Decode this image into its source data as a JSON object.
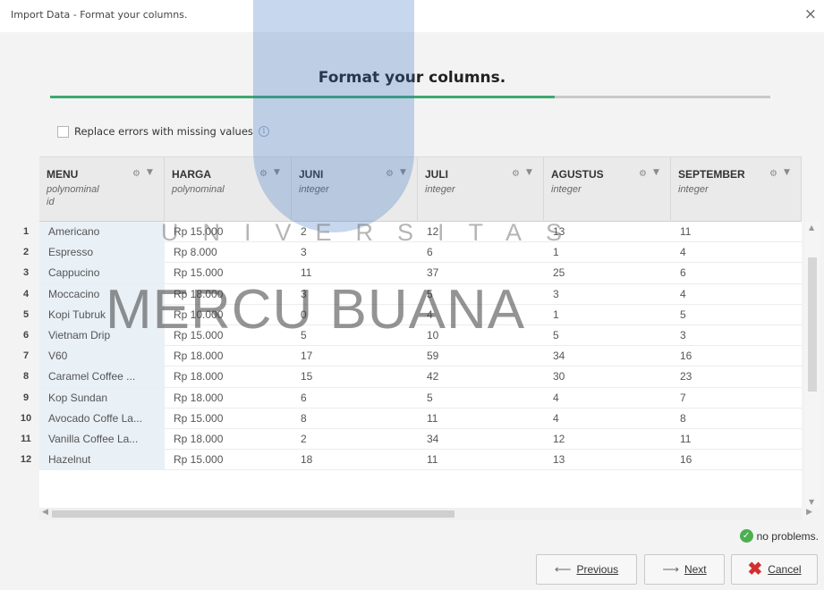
{
  "window": {
    "title": "Import Data - Format your columns.",
    "close_glyph": "×"
  },
  "heading": "Format your columns.",
  "progress": {
    "fraction": 0.7
  },
  "options": {
    "replace_errors_label": "Replace errors with missing values",
    "info_glyph": "i"
  },
  "columns": [
    {
      "name": "MENU",
      "type": "polynominal",
      "role": "id"
    },
    {
      "name": "HARGA",
      "type": "polynominal",
      "role": ""
    },
    {
      "name": "JUNI",
      "type": "integer",
      "role": ""
    },
    {
      "name": "JULI",
      "type": "integer",
      "role": ""
    },
    {
      "name": "AGUSTUS",
      "type": "integer",
      "role": ""
    },
    {
      "name": "SEPTEMBER",
      "type": "integer",
      "role": ""
    }
  ],
  "rows": [
    {
      "n": "1",
      "cells": [
        "Americano",
        "Rp 15.000",
        "2",
        "12",
        "13",
        "11"
      ]
    },
    {
      "n": "2",
      "cells": [
        "Espresso",
        "Rp 8.000",
        "3",
        "6",
        "1",
        "4"
      ]
    },
    {
      "n": "3",
      "cells": [
        "Cappucino",
        "Rp 15.000",
        "11",
        "37",
        "25",
        "6"
      ]
    },
    {
      "n": "4",
      "cells": [
        "Moccacino",
        "Rp 18.000",
        "3",
        "5",
        "3",
        "4"
      ]
    },
    {
      "n": "5",
      "cells": [
        "Kopi Tubruk",
        "Rp 10.000",
        "0",
        "4",
        "1",
        "5"
      ]
    },
    {
      "n": "6",
      "cells": [
        "Vietnam Drip",
        "Rp 15.000",
        "5",
        "10",
        "5",
        "3"
      ]
    },
    {
      "n": "7",
      "cells": [
        "V60",
        "Rp 18.000",
        "17",
        "59",
        "34",
        "16"
      ]
    },
    {
      "n": "8",
      "cells": [
        "Caramel Coffee ...",
        "Rp 18.000",
        "15",
        "42",
        "30",
        "23"
      ]
    },
    {
      "n": "9",
      "cells": [
        "Kop Sundan",
        "Rp 18.000",
        "6",
        "5",
        "4",
        "7"
      ]
    },
    {
      "n": "10",
      "cells": [
        "Avocado Coffe La...",
        "Rp 15.000",
        "8",
        "11",
        "4",
        "8"
      ]
    },
    {
      "n": "11",
      "cells": [
        "Vanilla Coffee La...",
        "Rp 18.000",
        "2",
        "34",
        "12",
        "11"
      ]
    },
    {
      "n": "12",
      "cells": [
        "Hazelnut",
        "Rp 15.000",
        "18",
        "11",
        "13",
        "16"
      ]
    }
  ],
  "status": {
    "text": "no problems.",
    "icon": "check-circle-icon",
    "icon_glyph": "✓"
  },
  "buttons": {
    "previous": "Previous",
    "next": "Next",
    "cancel": "Cancel",
    "left_arrow_glyph": "⟵",
    "right_arrow_glyph": "⟶",
    "cancel_glyph": "✖"
  },
  "watermark": {
    "line1": "UNIVERSITAS",
    "line2": "MERCU BUANA"
  },
  "colors": {
    "progress": "#3fa971",
    "menu_column_bg": "#e9f0f6",
    "ok": "#4caf50",
    "cancel_icon": "#d32f2f"
  }
}
